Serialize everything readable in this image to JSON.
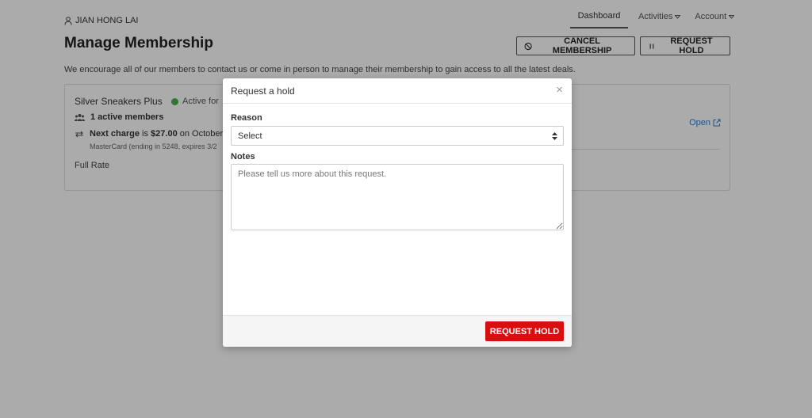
{
  "header": {
    "user_name": "JIAN HONG LAI",
    "nav": {
      "dashboard": "Dashboard",
      "activities": "Activities",
      "account": "Account"
    }
  },
  "page": {
    "title": "Manage Membership",
    "cancel_button": "CANCEL MEMBERSHIP",
    "hold_button": "REQUEST HOLD",
    "intro": "We encourage all of our members to contact us or come in person to manage their membership to gain access to all the latest deals."
  },
  "membership": {
    "name": "Silver Sneakers Plus",
    "status": "Active for",
    "members": "1 active members",
    "charge_label": "Next charge",
    "charge_is": " is ",
    "charge_amount": "$27.00",
    "charge_date": " on October",
    "card_info": "MasterCard (ending in 5248, expires 3/2",
    "rate": "Full Rate",
    "open_link": "Open",
    "status_color": "#4caf50"
  },
  "modal": {
    "title": "Request a hold",
    "close": "×",
    "reason_label": "Reason",
    "reason_value": "Select",
    "notes_label": "Notes",
    "notes_placeholder": "Please tell us more about this request.",
    "submit": "REQUEST HOLD",
    "submit_color": "#d90f0f"
  }
}
